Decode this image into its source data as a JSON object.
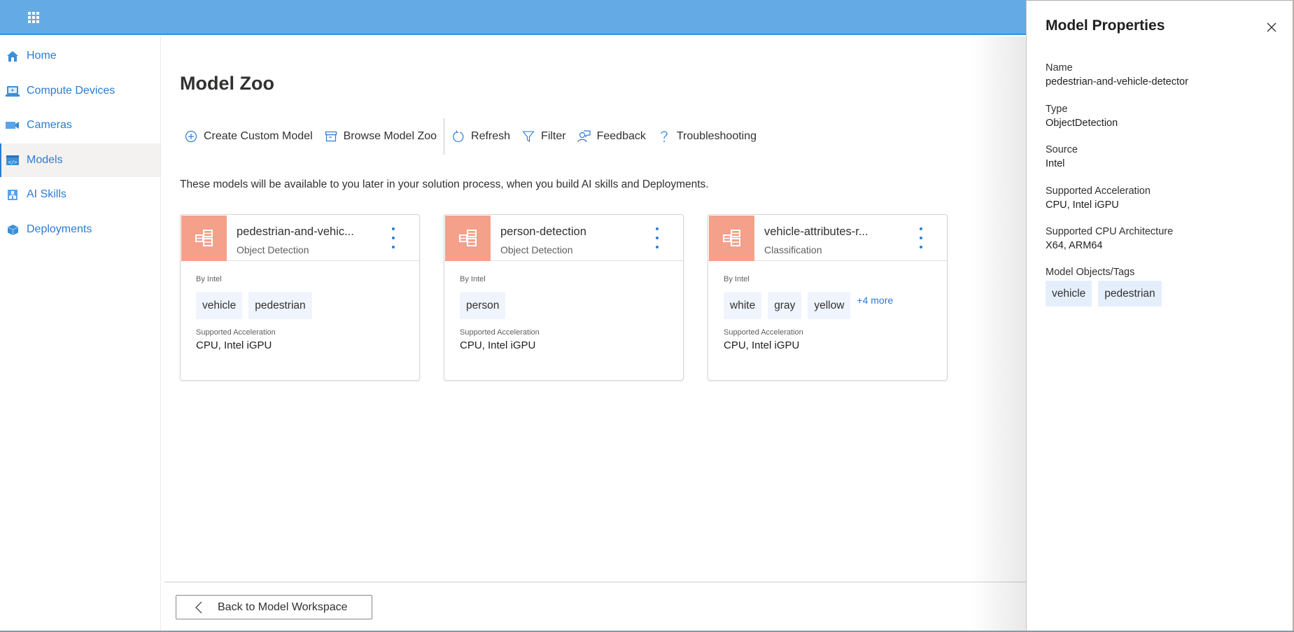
{
  "topbar": {
    "waffle_icon": "app-launcher-icon",
    "color": "#64abe6"
  },
  "sidebar": {
    "items": [
      {
        "label": "Home",
        "icon": "home-icon",
        "selected": false
      },
      {
        "label": "Compute Devices",
        "icon": "compute-device-icon",
        "selected": false
      },
      {
        "label": "Cameras",
        "icon": "camera-icon",
        "selected": false
      },
      {
        "label": "Models",
        "icon": "models-icon",
        "selected": true
      },
      {
        "label": "AI Skills",
        "icon": "ai-skills-icon",
        "selected": false
      },
      {
        "label": "Deployments",
        "icon": "deployments-icon",
        "selected": false
      }
    ]
  },
  "main": {
    "title": "Model Zoo",
    "toolbar": [
      {
        "label": "Create Custom Model",
        "icon": "add-circle-icon"
      },
      {
        "label": "Browse Model Zoo",
        "icon": "archive-icon"
      },
      {
        "label": "Refresh",
        "icon": "refresh-icon"
      },
      {
        "label": "Filter",
        "icon": "filter-icon"
      },
      {
        "label": "Feedback",
        "icon": "feedback-icon"
      },
      {
        "label": "Troubleshooting",
        "icon": "help-icon"
      }
    ],
    "description": "These models will be available to you later in your solution process, when you build AI skills and Deployments.",
    "cards": [
      {
        "title": "pedestrian-and-vehic...",
        "subtitle": "Object Detection",
        "by": "By Intel",
        "tags": [
          "vehicle",
          "pedestrian"
        ],
        "more": "",
        "acc_label": "Supported Acceleration",
        "acc_value": "CPU, Intel iGPU"
      },
      {
        "title": "person-detection",
        "subtitle": "Object Detection",
        "by": "By Intel",
        "tags": [
          "person"
        ],
        "more": "",
        "acc_label": "Supported Acceleration",
        "acc_value": "CPU, Intel iGPU"
      },
      {
        "title": "vehicle-attributes-r...",
        "subtitle": "Classification",
        "by": "By Intel",
        "tags": [
          "white",
          "gray",
          "yellow"
        ],
        "more": "+4 more",
        "acc_label": "Supported Acceleration",
        "acc_value": "CPU, Intel iGPU"
      }
    ],
    "card_icon_color": "#f4a08b",
    "back_button": "Back to Model Workspace"
  },
  "panel": {
    "title": "Model Properties",
    "props": [
      {
        "label": "Name",
        "value": "pedestrian-and-vehicle-detector"
      },
      {
        "label": "Type",
        "value": "ObjectDetection"
      },
      {
        "label": "Source",
        "value": "Intel"
      },
      {
        "label": "Supported Acceleration",
        "value": "CPU, Intel iGPU"
      },
      {
        "label": "Supported CPU Architecture",
        "value": "X64, ARM64"
      }
    ],
    "tags_label": "Model Objects/Tags",
    "tags": [
      "vehicle",
      "pedestrian"
    ]
  }
}
